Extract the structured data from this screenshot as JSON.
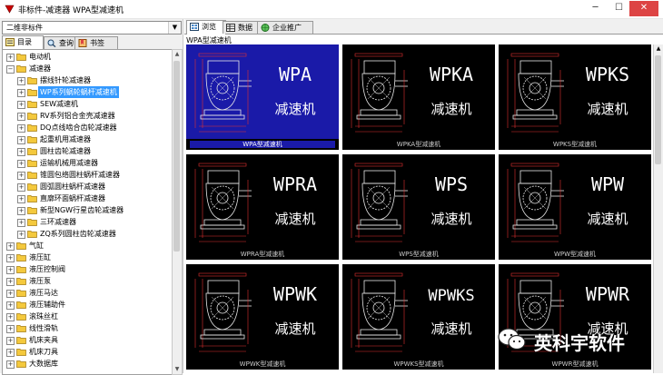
{
  "window": {
    "title": "非标件-减速器 WPA型减速机"
  },
  "left": {
    "combo_value": "二维非标件",
    "tabs": [
      {
        "label": "目录"
      },
      {
        "label": "查询"
      },
      {
        "label": "书签"
      }
    ],
    "tree": [
      {
        "label": "电动机",
        "level": 0,
        "expanded": false
      },
      {
        "label": "减速器",
        "level": 0,
        "expanded": true
      },
      {
        "label": "摆线针轮减速器",
        "level": 1
      },
      {
        "label": "WP系列蜗轮蜗杆减速机",
        "level": 1,
        "selected": true
      },
      {
        "label": "SEW减速机",
        "level": 1
      },
      {
        "label": "RV系列铝合金壳减速器",
        "level": 1
      },
      {
        "label": "DQ点线啮合齿轮减速器",
        "level": 1
      },
      {
        "label": "起重机用减速器",
        "level": 1
      },
      {
        "label": "圆柱齿轮减速器",
        "level": 1
      },
      {
        "label": "运输机械用减速器",
        "level": 1
      },
      {
        "label": "锥圆包络圆柱蜗杆减速器",
        "level": 1
      },
      {
        "label": "圆弧圆柱蜗杆减速器",
        "level": 1
      },
      {
        "label": "直廓环面蜗杆减速器",
        "level": 1
      },
      {
        "label": "新型NGW行星齿轮减速器",
        "level": 1
      },
      {
        "label": "三环减速器",
        "level": 1
      },
      {
        "label": "ZQ系列圆柱齿轮减速器",
        "level": 1
      },
      {
        "label": "气缸",
        "level": 0
      },
      {
        "label": "液压缸",
        "level": 0
      },
      {
        "label": "液压控制阀",
        "level": 0
      },
      {
        "label": "液压泵",
        "level": 0
      },
      {
        "label": "液压马达",
        "level": 0
      },
      {
        "label": "液压辅助件",
        "level": 0
      },
      {
        "label": "滚珠丝杠",
        "level": 0
      },
      {
        "label": "线性滑轨",
        "level": 0
      },
      {
        "label": "机床夹具",
        "level": 0
      },
      {
        "label": "机床刀具",
        "level": 0
      },
      {
        "label": "大数据库",
        "level": 0
      }
    ]
  },
  "right": {
    "tabs": [
      {
        "label": "浏览"
      },
      {
        "label": "数据"
      },
      {
        "label": "企业推广"
      }
    ],
    "drawing_name": "WPA型减速机",
    "cells": [
      {
        "model": "WPA",
        "caption": "WPA型减速机",
        "selected": true
      },
      {
        "model": "WPKA",
        "caption": "WPKA型减速机"
      },
      {
        "model": "WPKS",
        "caption": "WPKS型减速机"
      },
      {
        "model": "WPRA",
        "caption": "WPRA型减速机"
      },
      {
        "model": "WPS",
        "caption": "WPS型减速机"
      },
      {
        "model": "WPW",
        "caption": "WPW型减速机"
      },
      {
        "model": "WPWK",
        "caption": "WPWK型减速机"
      },
      {
        "model": "WPWKS",
        "caption": "WPWKS型减速机"
      },
      {
        "model": "WPWR",
        "caption": "WPWR型减速机"
      }
    ],
    "cell_subtitle": "减速机"
  },
  "watermark": {
    "text": "英科宇软件"
  },
  "colors": {
    "selection": "#3399ff",
    "cad_bg": "#000000",
    "cad_selected": "#1a1aa8",
    "dim_red": "#e03030",
    "line_white": "#e8e8e8"
  }
}
